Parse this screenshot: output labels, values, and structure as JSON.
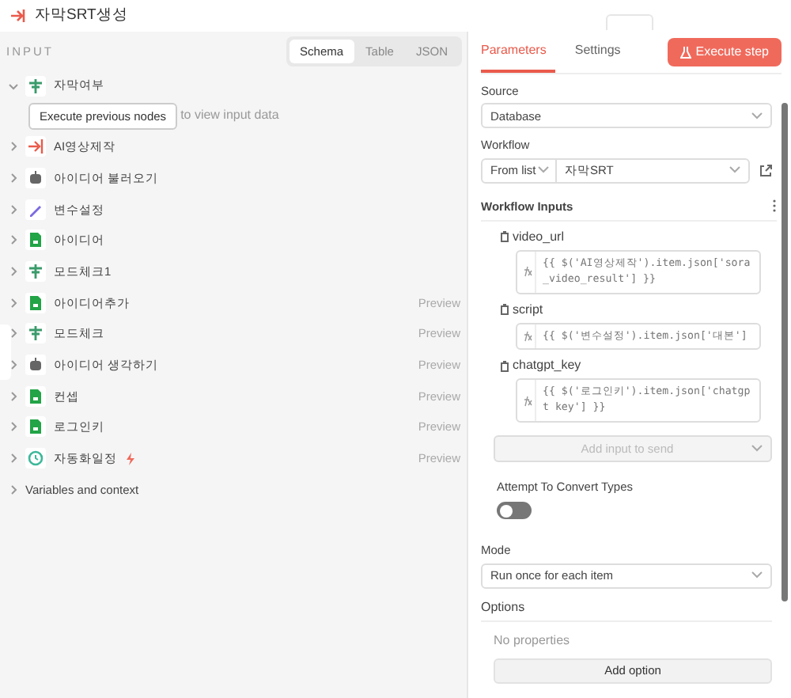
{
  "header": {
    "title": "자막SRT생성"
  },
  "input_panel": {
    "heading": "INPUT",
    "view_tabs": [
      {
        "label": "Schema",
        "selected": true
      },
      {
        "label": "Table",
        "selected": false
      },
      {
        "label": "JSON",
        "selected": false
      }
    ],
    "nodes": [
      {
        "label": "자막여부",
        "kind": "switch",
        "expanded": true,
        "execute_button": "Execute previous nodes",
        "hint": "to view input data"
      },
      {
        "label": "AI영상제작",
        "kind": "exec",
        "expanded": false
      },
      {
        "label": "아이디어 불러오기",
        "kind": "ai",
        "expanded": false
      },
      {
        "label": "변수설정",
        "kind": "edit",
        "expanded": false
      },
      {
        "label": "아이디어",
        "kind": "sheet",
        "expanded": false
      },
      {
        "label": "모드체크1",
        "kind": "switch",
        "expanded": false
      },
      {
        "label": "아이디어추가",
        "kind": "sheet",
        "expanded": false,
        "preview": "Preview"
      },
      {
        "label": "모드체크",
        "kind": "switch",
        "expanded": false,
        "preview": "Preview"
      },
      {
        "label": "아이디어 생각하기",
        "kind": "ai",
        "expanded": false,
        "preview": "Preview"
      },
      {
        "label": "컨셉",
        "kind": "sheet",
        "expanded": false,
        "preview": "Preview"
      },
      {
        "label": "로그인키",
        "kind": "sheet",
        "expanded": false,
        "preview": "Preview"
      },
      {
        "label": "자동화일정",
        "kind": "clock",
        "expanded": false,
        "trigger": true,
        "preview": "Preview"
      }
    ],
    "variables": {
      "label": "Variables and context",
      "expanded": false
    }
  },
  "params_panel": {
    "tabs": [
      {
        "label": "Parameters",
        "selected": true
      },
      {
        "label": "Settings",
        "selected": false
      }
    ],
    "execute_button": "Execute step",
    "source": {
      "label": "Source",
      "value": "Database"
    },
    "workflow": {
      "label": "Workflow",
      "mode": "From list",
      "value": "자막SRT"
    },
    "workflow_inputs": {
      "heading": "Workflow Inputs",
      "inputs": [
        {
          "name": "video_url",
          "expression": "{{ $('AI영상제작').item.json['sora_video_result'] }}"
        },
        {
          "name": "script",
          "expression": "{{ $('변수설정').item.json['대본']"
        },
        {
          "name": "chatgpt_key",
          "expression": "{{ $('로그인키').item.json['chatgpt key'] }}"
        }
      ],
      "add_input": {
        "placeholder": "Add input to send",
        "disabled": true
      }
    },
    "convert_types": {
      "label": "Attempt To Convert Types",
      "on": false
    },
    "mode": {
      "label": "Mode",
      "value": "Run once for each item"
    },
    "options": {
      "heading": "Options",
      "empty_text": "No properties",
      "add_button": "Add option"
    }
  }
}
